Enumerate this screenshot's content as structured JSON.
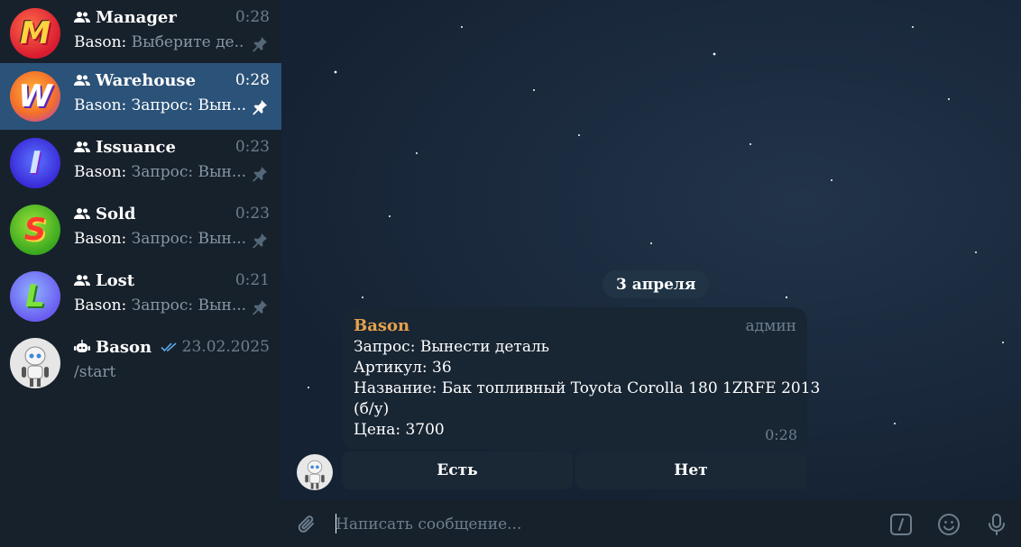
{
  "chats": [
    {
      "title": "Manager",
      "time": "0:28",
      "sender": "Bason:",
      "preview": "Выберите де...",
      "type": "group",
      "pinned": true,
      "active": false
    },
    {
      "title": "Warehouse",
      "time": "0:28",
      "sender": "Bason:",
      "preview": "Запрос: Вын...",
      "type": "group",
      "pinned": true,
      "active": true
    },
    {
      "title": "Issuance",
      "time": "0:23",
      "sender": "Bason:",
      "preview": "Запрос: Вын...",
      "type": "group",
      "pinned": true,
      "active": false
    },
    {
      "title": "Sold",
      "time": "0:23",
      "sender": "Bason:",
      "preview": "Запрос: Вын...",
      "type": "group",
      "pinned": true,
      "active": false
    },
    {
      "title": "Lost",
      "time": "0:21",
      "sender": "Bason:",
      "preview": "Запрос: Вын...",
      "type": "group",
      "pinned": true,
      "active": false
    },
    {
      "title": "Bason",
      "time": "23.02.2025",
      "sender": "",
      "preview": "/start",
      "type": "bot",
      "pinned": false,
      "active": false
    }
  ],
  "conversation": {
    "date_divider": "3 апреля",
    "message": {
      "sender": "Bason",
      "badge": "админ",
      "lines": [
        "Запрос: Вынести деталь",
        "Артикул: 36",
        "Название: Бак топливный Toyota Corolla 180 1ZRFE 2013",
        "(б/у)",
        "Цена: 3700"
      ],
      "time": "0:28"
    },
    "keyboard": [
      "Есть",
      "Нет"
    ]
  },
  "composer": {
    "placeholder": "Написать сообщение..."
  },
  "colors": {
    "sidebar_bg": "#17212b",
    "active_chat_bg": "#2b5278",
    "bubble_bg": "#182533",
    "sender_name": "#e4a14c",
    "muted_text": "#6d7f8f",
    "read_check": "#5ea8e8"
  },
  "icons": {
    "group": "group-icon",
    "bot": "bot-icon",
    "pin": "pin-icon",
    "read": "double-check-icon",
    "attach": "paperclip-icon",
    "commands": "slash-command-icon",
    "emoji": "emoji-icon",
    "mic": "microphone-icon"
  }
}
